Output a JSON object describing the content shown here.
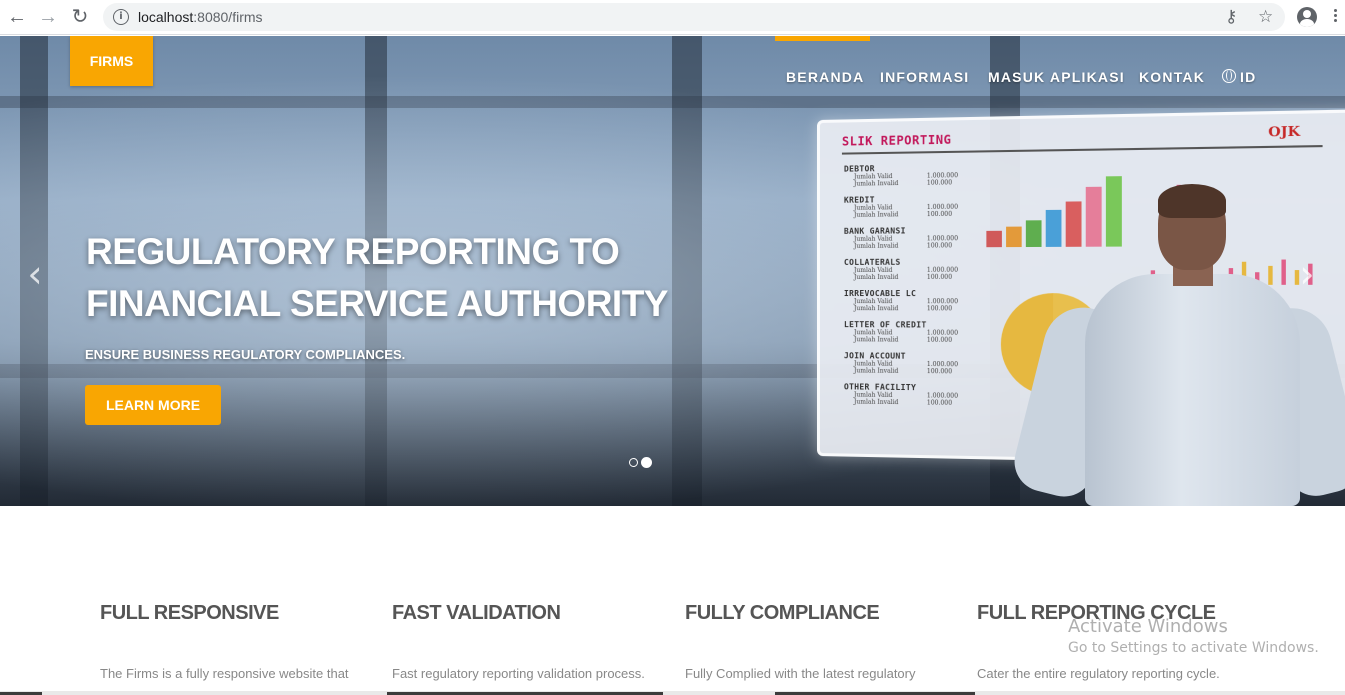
{
  "browser": {
    "url_host": "localhost",
    "url_rest": ":8080/firms",
    "back_icon": "back-arrow-icon",
    "forward_icon": "forward-arrow-icon",
    "reload_icon": "reload-icon",
    "info_glyph": "i"
  },
  "site": {
    "brand": "FIRMS",
    "menu": [
      "BERANDA",
      "INFORMASI",
      "MASUK APLIKASI",
      "KONTAK"
    ],
    "lang": "ID",
    "accent_color": "#f9a602"
  },
  "hero": {
    "title_line1": "REGULATORY REPORTING TO",
    "title_line2": "FINANCIAL SERVICE AUTHORITY",
    "subtitle": "ENSURE BUSINESS REGULATORY COMPLIANCES.",
    "cta": "LEARN MORE",
    "prev_glyph": "‹",
    "next_glyph": "›",
    "slides_total": 2,
    "active_slide": 2
  },
  "dashboard": {
    "title": "SLIK REPORTING",
    "logo": "OJK",
    "items": [
      {
        "label": "DEBTOR",
        "rows": [
          [
            "Jumlah Valid",
            "1.000.000"
          ],
          [
            "Jumlah Invalid",
            "100.000"
          ]
        ]
      },
      {
        "label": "KREDIT",
        "rows": [
          [
            "Jumlah Valid",
            "1.000.000"
          ],
          [
            "Jumlah Invalid",
            "100.000"
          ]
        ]
      },
      {
        "label": "BANK GARANSI",
        "rows": [
          [
            "Jumlah Valid",
            "1.000.000"
          ],
          [
            "Jumlah Invalid",
            "100.000"
          ]
        ]
      },
      {
        "label": "COLLATERALS",
        "rows": [
          [
            "Jumlah Valid",
            "1.000.000"
          ],
          [
            "Jumlah Invalid",
            "100.000"
          ]
        ]
      },
      {
        "label": "IRREVOCABLE LC",
        "rows": [
          [
            "Jumlah Valid",
            "1.000.000"
          ],
          [
            "Jumlah Invalid",
            "100.000"
          ]
        ]
      },
      {
        "label": "LETTER OF CREDIT",
        "rows": [
          [
            "Jumlah Valid",
            "1.000.000"
          ],
          [
            "Jumlah Invalid",
            "100.000"
          ]
        ]
      },
      {
        "label": "JOIN ACCOUNT",
        "rows": [
          [
            "Jumlah Valid",
            "1.000.000"
          ],
          [
            "Jumlah Invalid",
            "100.000"
          ]
        ]
      },
      {
        "label": "OTHER FACILITY",
        "rows": [
          [
            "Jumlah Valid",
            "1.000.000"
          ],
          [
            "Jumlah Invalid",
            "100.000"
          ]
        ]
      }
    ]
  },
  "features": [
    {
      "title": "FULL RESPONSIVE",
      "text": "The Firms is a fully responsive website that"
    },
    {
      "title": "FAST VALIDATION",
      "text": "Fast regulatory reporting validation process."
    },
    {
      "title": "FULLY COMPLIANCE",
      "text": "Fully Complied with the latest regulatory"
    },
    {
      "title": "FULL REPORTING CYCLE",
      "text": "Cater the entire regulatory reporting cycle."
    }
  ],
  "watermark": {
    "line1": "Activate Windows",
    "line2": "Go to Settings to activate Windows."
  }
}
